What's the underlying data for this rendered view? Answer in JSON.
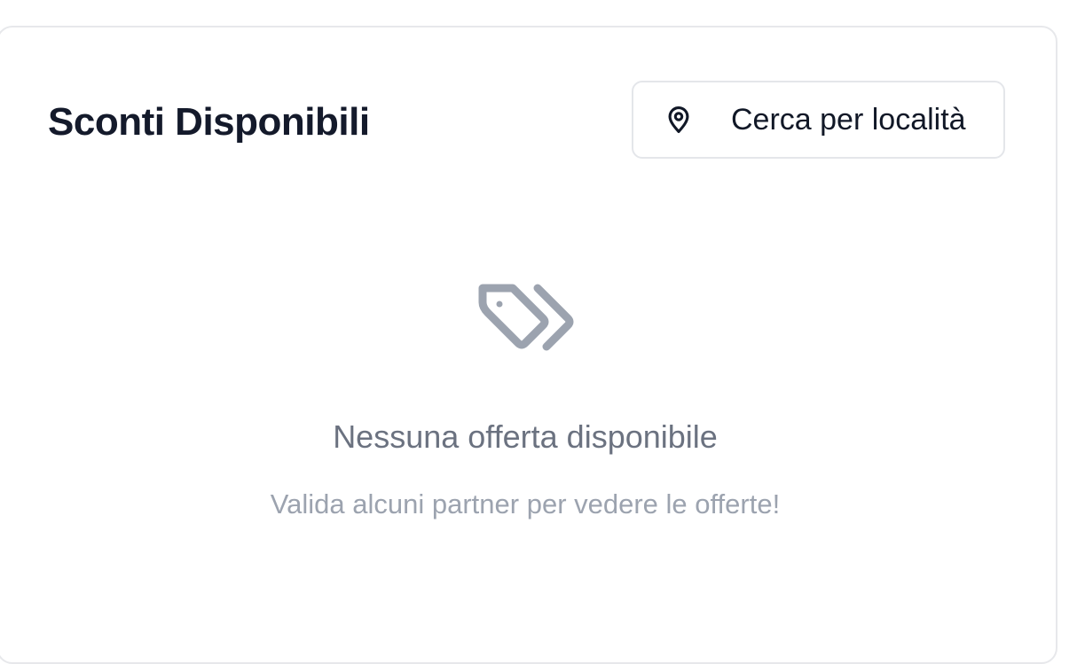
{
  "card": {
    "title": "Sconti Disponibili",
    "location_button": {
      "icon": "map-pin-icon",
      "label": "Cerca per località"
    }
  },
  "empty_state": {
    "icon": "tags-icon",
    "title": "Nessuna offerta disponibile",
    "subtitle": "Valida alcuni partner per vedere le offerte!"
  },
  "colors": {
    "title": "#141a2b",
    "empty_icon": "#9ca3af",
    "empty_title": "#6b7280",
    "empty_subtitle": "#9ca3af",
    "border": "#e7e8eb"
  }
}
